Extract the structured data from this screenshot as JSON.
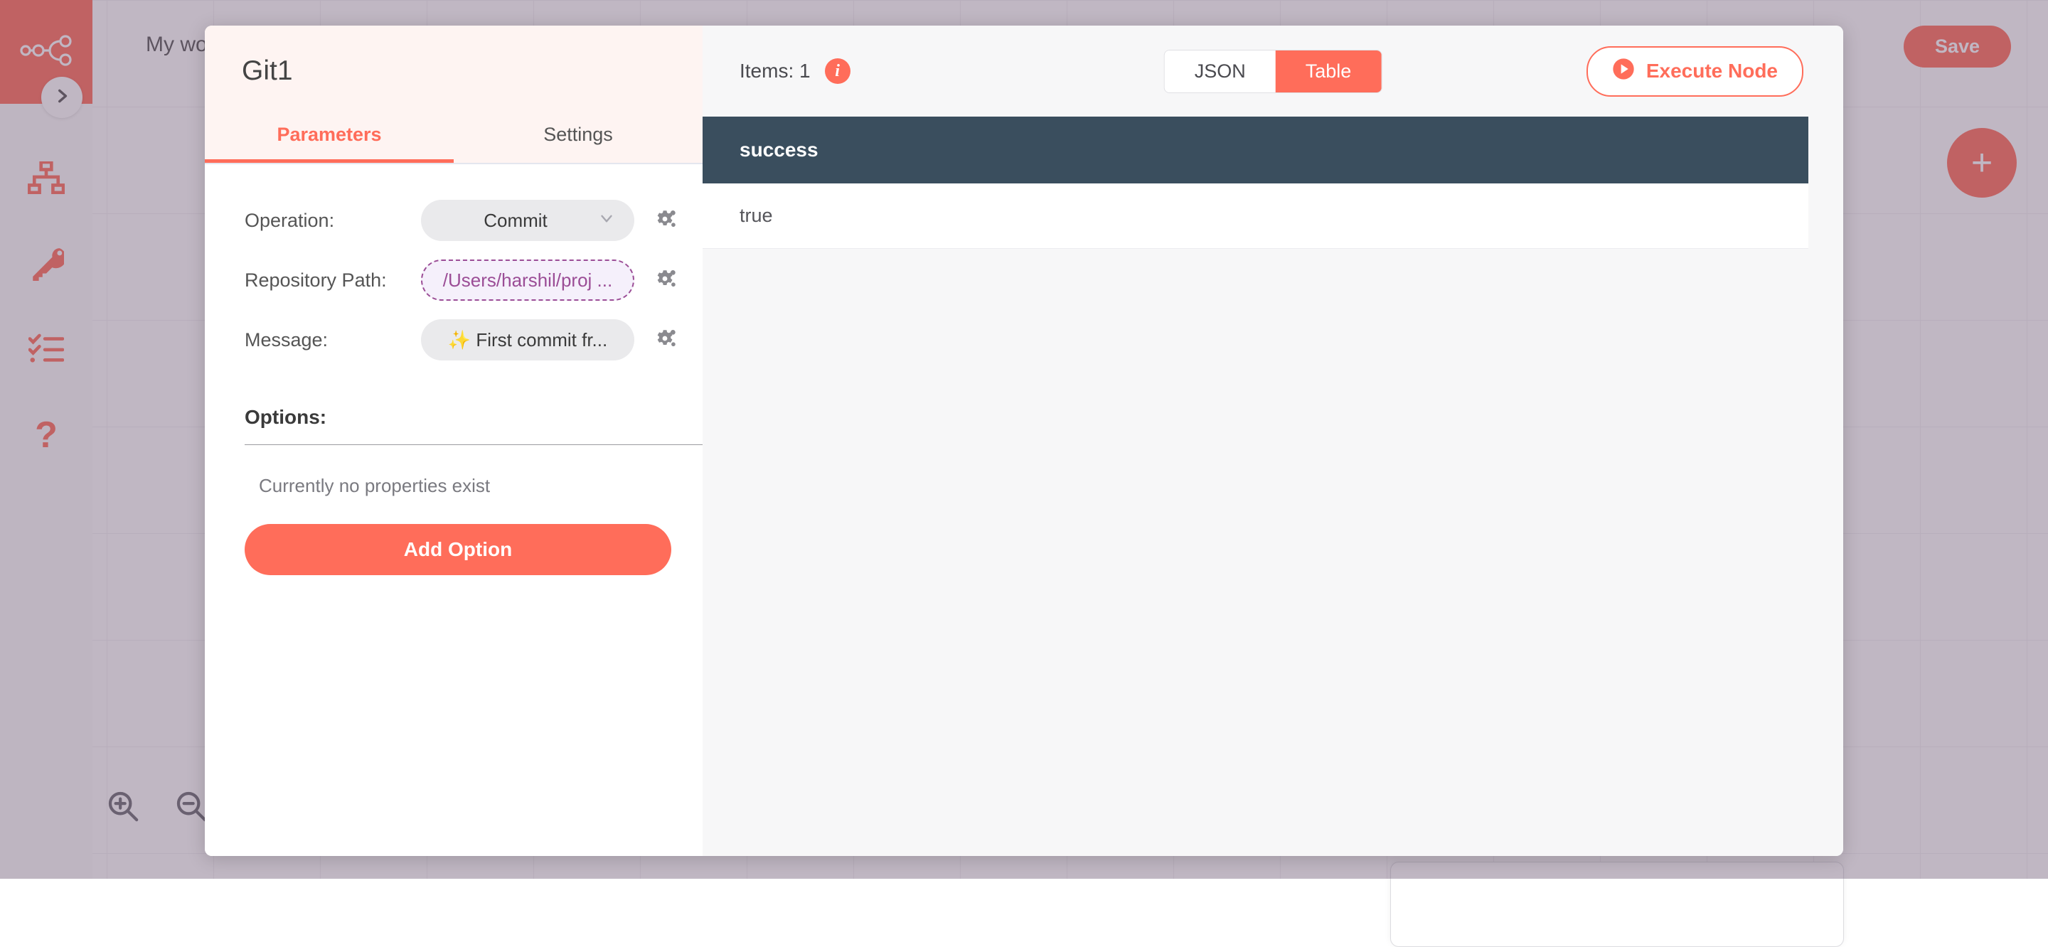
{
  "canvas": {
    "workflow_name": "My workflow",
    "save_label": "Save",
    "add_node_label": "+",
    "sidebar": {
      "items": [
        {
          "icon": "n8n-workflow-logo-icon",
          "label": "n8n"
        },
        {
          "icon": "chevron-right-icon",
          "label": "Expand sidebar"
        },
        {
          "icon": "sitemap-icon",
          "label": "Workflows"
        },
        {
          "icon": "key-icon",
          "label": "Credentials"
        },
        {
          "icon": "checklist-icon",
          "label": "Executions"
        },
        {
          "icon": "question-mark-icon",
          "label": "Help"
        }
      ]
    },
    "zoom_controls": [
      {
        "icon": "zoom-in-icon",
        "label": "Zoom in"
      },
      {
        "icon": "zoom-out-icon",
        "label": "Zoom out"
      }
    ]
  },
  "ndv": {
    "node_title": "Git1",
    "tabs": [
      {
        "label": "Parameters",
        "active": true
      },
      {
        "label": "Settings",
        "active": false
      }
    ],
    "parameters": [
      {
        "label": "Operation:",
        "value": "Commit",
        "type": "select",
        "icon": "chevron-down-icon",
        "cogs_icon": "cogs-icon"
      },
      {
        "label": "Repository Path:",
        "value": "/Users/harshil/proj  ...",
        "type": "expression",
        "cogs_icon": "cogs-icon"
      },
      {
        "label": "Message:",
        "value": "✨ First commit fr...",
        "type": "text",
        "cogs_icon": "cogs-icon"
      }
    ],
    "options": {
      "title": "Options:",
      "empty_text": "Currently no properties exist",
      "add_button_label": "Add Option"
    },
    "close_label": "✕"
  },
  "output": {
    "items_label": "Items: 1",
    "info_icon": "info-icon",
    "info_glyph": "i",
    "view_toggle": [
      {
        "label": "JSON",
        "active": false
      },
      {
        "label": "Table",
        "active": true
      }
    ],
    "execute_label": "Execute Node",
    "execute_icon": "play-circle-icon",
    "table": {
      "columns": [
        "success"
      ],
      "rows": [
        [
          "true"
        ]
      ]
    }
  },
  "colors": {
    "accent": "#ff6d5a",
    "dark_slate": "#3a4e5e",
    "expression_purple": "#9b4d96",
    "panel_head": "#fef4f2"
  }
}
